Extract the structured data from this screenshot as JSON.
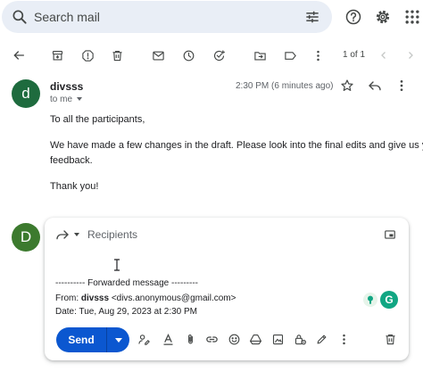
{
  "search": {
    "placeholder": "Search mail"
  },
  "pagination": {
    "text": "1 of 1"
  },
  "message": {
    "avatar_letter": "d",
    "sender": "divsss",
    "to_line": "to me",
    "time": "2:30 PM (6 minutes ago)",
    "body": [
      "To all the participants,",
      "We have made a few changes in the draft. Please look into the final edits and give us your",
      "feedback.",
      "Thank you!"
    ]
  },
  "compose": {
    "avatar_letter": "D",
    "recipients_placeholder": "Recipients",
    "forwarded_header": "---------- Forwarded message ---------",
    "from_label": "From:",
    "from_name": "divsss",
    "from_email": "<divs.anonymous@gmail.com>",
    "date_line": "Date: Tue, Aug 29, 2023 at 2:30 PM",
    "send_label": "Send",
    "extension_letter": "G"
  },
  "colors": {
    "send": "#0b57d0",
    "search_bg": "#e9eef6",
    "avatar_sender": "#1e6b3e",
    "avatar_self": "#3c7a2e"
  }
}
